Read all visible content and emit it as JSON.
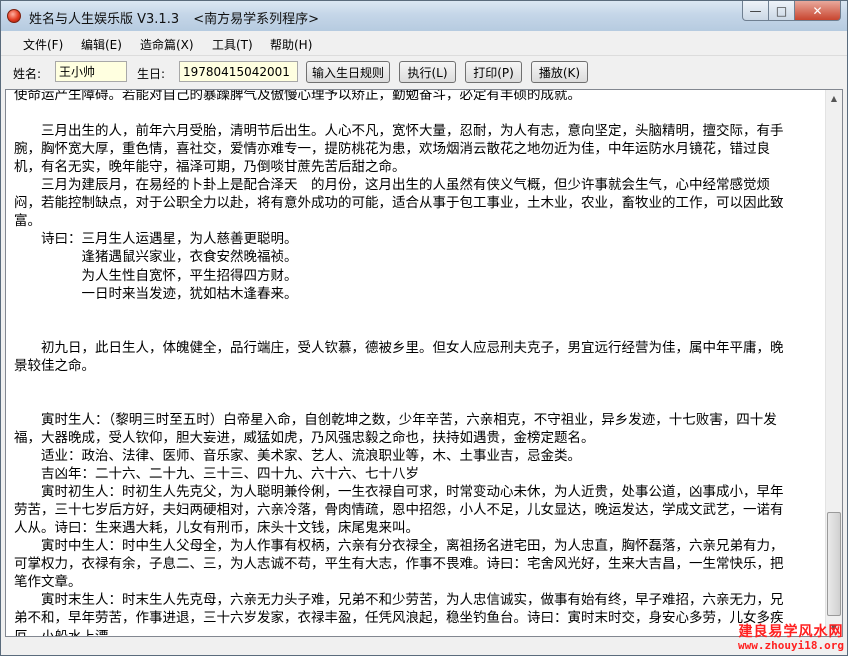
{
  "window": {
    "title": "姓名与人生娱乐版 V3.1.3",
    "subtitle": "<南方易学系列程序>",
    "minimize": "—",
    "maximize": "□",
    "close": "✕"
  },
  "menu": [
    "文件(F)",
    "编辑(E)",
    "造命篇(X)",
    "工具(T)",
    "帮助(H)"
  ],
  "toolbar": {
    "name_label": "姓名:",
    "name_value": "王小帅",
    "birthday_label": "生日:",
    "birthday_value": "19780415042001",
    "rule_button": "输入生日规则",
    "run_button": "执行(L)",
    "print_button": "打印(P)",
    "play_button": "播放(K)"
  },
  "content_lines": [
    "使命运产生障碍。若能对自己的暴躁脾气及傲慢心理予以矫正，勤勉奋斗，必定有丰硕的成就。",
    "",
    "　　三月出生的人，前年六月受胎，清明节后出生。人心不凡，宽怀大量，忍耐，为人有志，意向坚定，头脑精明，擅交际，有手",
    "腕，胸怀宽大厚，重色情，喜社交，爱情亦难专一，提防桃花为患，欢场烟消云散花之地勿近为佳，中年运防水月镜花，错过良",
    "机，有名无实，晚年能守，福泽可期，乃倒啖甘蔗先苦后甜之命。",
    "　　三月为建辰月，在易经的卜卦上是配合泽天　的月份，这月出生的人虽然有侠义气概，但少许事就会生气，心中经常感觉烦",
    "闷，若能控制缺点，对于公职全力以赴，将有意外成功的可能，适合从事于包工事业，土木业，农业，畜牧业的工作，可以因此致",
    "富。",
    "　　诗曰：三月生人运遇星，为人慈善更聪明。",
    "　　　　　逢猪遇鼠兴家业，衣食安然晚福祯。",
    "　　　　　为人生性自宽怀，平生招得四方财。",
    "　　　　　一日时来当发迹，犹如枯木逢春来。",
    "",
    "",
    "　　初九日，此日生人，体魄健全，品行端庄，受人钦慕，德被乡里。但女人应忌刑夫克子，男宜远行经营为佳，属中年平庸，晚",
    "景较佳之命。",
    "",
    "",
    "　　寅时生人：（黎明三时至五时）白帝星入命，自创乾坤之数，少年辛苦，六亲相克，不守祖业，异乡发迹，十七败害，四十发",
    "福，大器晚成，受人钦仰，胆大妄进，威猛如虎，乃风强忠毅之命也，扶持如遇贵，金榜定题名。",
    "　　适业：政治、法律、医师、音乐家、美术家、艺人、流浪职业等，木、土事业吉，忌金类。",
    "　　吉凶年：二十六、二十九、三十三、四十九、六十六、七十八岁",
    "　　寅时初生人：时初生人先克父，为人聪明兼伶俐，一生衣禄自可求，时常变动心未休，为人近贵，处事公道，凶事成小，早年",
    "劳苦，三十七岁后方好，夫妇两硬相对，六亲冷落，骨肉情疏，恩中招怨，小人不足，儿女显达，晚运发达，学成文武艺，一诺有",
    "人从。诗曰：生来遇大耗，儿女有刑币，床头十文钱，床尾鬼来叫。",
    "　　寅时中生人：时中生人父母全，为人作事有权柄，六亲有分衣禄全，离祖扬名进宅田，为人忠直，胸怀磊落，六亲兄弟有力，",
    "可掌权力，衣禄有余，子息二、三，为人志诚不苟，平生有大志，作事不畏难。诗曰：宅舍风光好，生来大吉昌，一生常快乐，把",
    "笔作文章。",
    "　　寅时末生人：时末生人先克母，六亲无力头子难，兄弟不和少劳苦，为人忠信诚实，做事有始有终，早子难招，六亲无力，兄",
    "弟不和，早年劳苦，作事进退，三十六岁发家，衣禄丰盈，任凭风浪起，稳坐钓鱼台。诗曰：寅时末时交，身安心多劳，儿女多疾",
    "厄，小船水上漂。"
  ],
  "scrollbar": {
    "up": "▲",
    "down": "▼"
  },
  "watermark": {
    "line1": "建良易学风水网",
    "line2": "www.zhouyi18.org"
  }
}
